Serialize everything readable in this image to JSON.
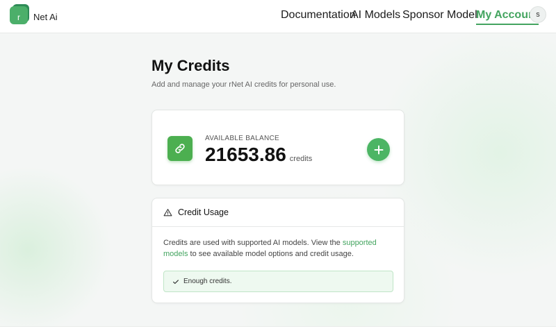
{
  "brand": {
    "logo_letter": "r",
    "name": "Net Ai"
  },
  "nav": {
    "items": [
      {
        "label": "Documentation"
      },
      {
        "label": "AI Models"
      },
      {
        "label": "Sponsor Model"
      },
      {
        "label": "My Account"
      }
    ],
    "active": "My Account"
  },
  "user": {
    "avatar_initial": "s"
  },
  "page": {
    "title": "My Credits",
    "subtitle": "Add and manage your rNet AI credits for personal use."
  },
  "balance": {
    "label": "AVAILABLE BALANCE",
    "amount": "21653.86",
    "unit": "credits",
    "icon": "link-icon",
    "add_icon": "plus-icon"
  },
  "usage": {
    "icon": "warning-icon",
    "title": "Credit Usage",
    "text_before": "Credits are used with supported AI models. View the ",
    "link_text": "supported models",
    "text_after": " to see available model options and credit usage.",
    "status_icon": "check-icon",
    "status_text": "Enough credits."
  },
  "colors": {
    "accent": "#43a45f",
    "button": "#4cb564",
    "status_bg": "#eef9f0"
  }
}
